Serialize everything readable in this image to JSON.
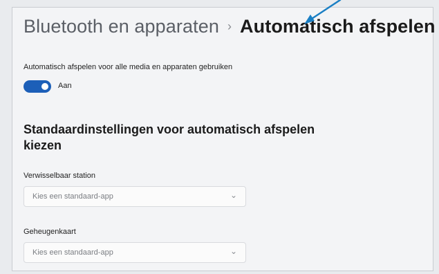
{
  "breadcrumb": {
    "parent": "Bluetooth en apparaten",
    "separator": "›",
    "current": "Automatisch afspelen"
  },
  "autoplay": {
    "description": "Automatisch afspelen voor alle media en apparaten gebruiken",
    "toggle_on": true,
    "toggle_state_label": "Aan"
  },
  "defaults_section": {
    "heading": "Standaardinstellingen voor automatisch afspelen kiezen",
    "fields": [
      {
        "label": "Verwisselbaar station",
        "value": "Kies een standaard-app"
      },
      {
        "label": "Geheugenkaart",
        "value": "Kies een standaard-app"
      }
    ]
  },
  "colors": {
    "accent": "#1c5fb8",
    "annotation_arrow": "#1a7fc4"
  },
  "icons": {
    "dropdown": "chevron-down-icon",
    "annotation": "arrow-icon"
  }
}
